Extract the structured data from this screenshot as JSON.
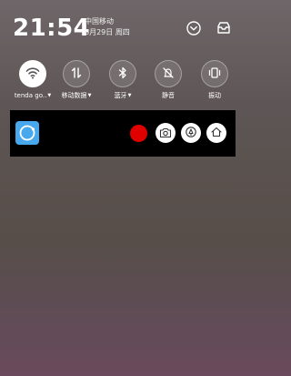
{
  "status_bar": {
    "time": "21:54",
    "carrier": "中国移动",
    "date": "8月29日 周四",
    "icons": [
      "chevron-down-circle-icon",
      "inbox-icon"
    ]
  },
  "quick_toggles": [
    {
      "label": "tenda go..",
      "icon": "wifi-icon",
      "active": true,
      "has_dropdown": true
    },
    {
      "label": "移动数据",
      "icon": "mobile-data-icon",
      "active": false,
      "has_dropdown": true
    },
    {
      "label": "蓝牙",
      "icon": "bluetooth-icon",
      "active": false,
      "has_dropdown": true
    },
    {
      "label": "静音",
      "icon": "mute-icon",
      "active": false,
      "has_dropdown": false
    },
    {
      "label": "振动",
      "icon": "vibrate-icon",
      "active": false,
      "has_dropdown": false
    }
  ],
  "recorder_bar": {
    "app_icon": "screen-recorder-app-icon",
    "buttons": [
      "record-icon",
      "camera-icon",
      "brush-icon",
      "home-icon"
    ]
  },
  "colors": {
    "record": "#e00000",
    "app_icon": "#47a8ee",
    "bar_bg": "#000000"
  }
}
